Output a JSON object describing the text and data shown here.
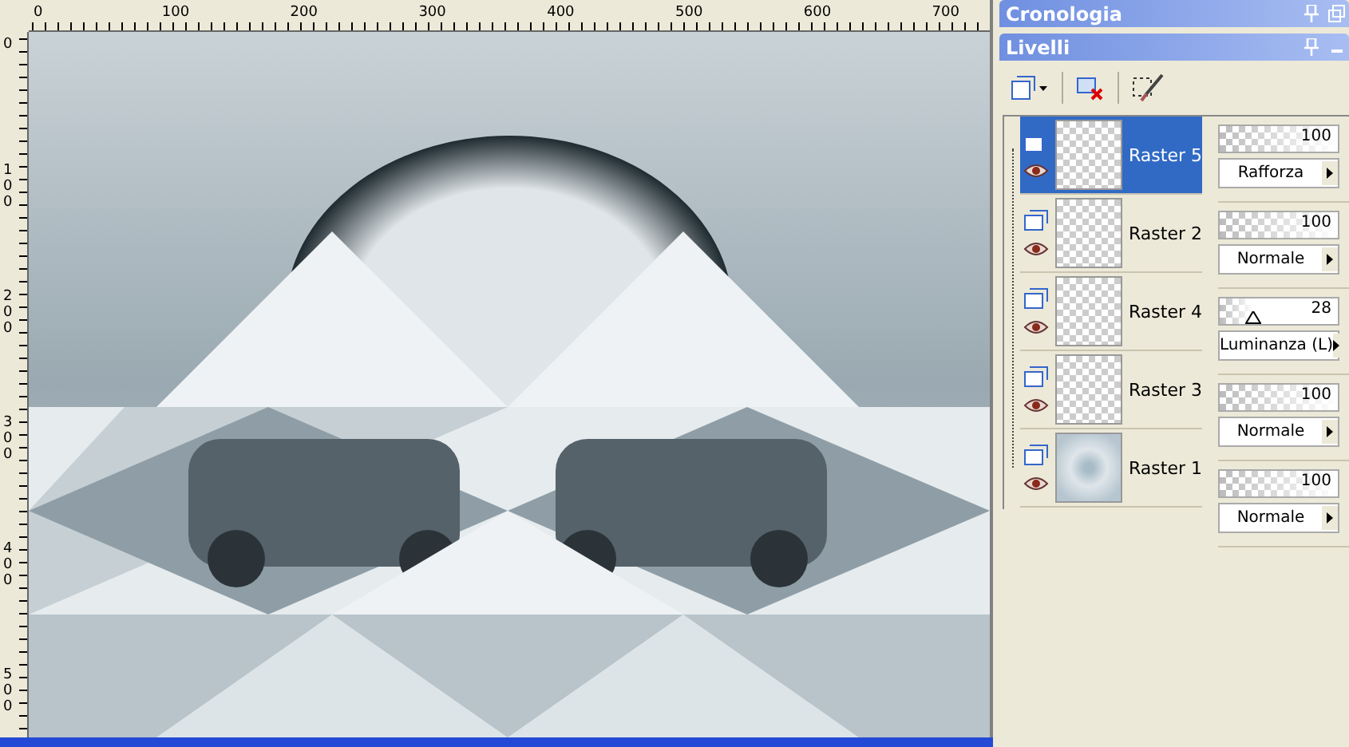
{
  "rulers": {
    "horizontal": [
      "0",
      "100",
      "200",
      "300",
      "400",
      "500",
      "600",
      "700"
    ],
    "vertical": [
      "0",
      "100",
      "200",
      "300",
      "400",
      "500"
    ]
  },
  "history_panel": {
    "title": "Cronologia"
  },
  "layers_panel": {
    "title": "Livelli",
    "layers": [
      {
        "name": "Raster 5",
        "selected": true,
        "kind": "transparent",
        "opacity": "100",
        "level": 1,
        "blend_mode": "Rafforza"
      },
      {
        "name": "Raster 2",
        "selected": false,
        "kind": "transparent",
        "opacity": "100",
        "level": 1,
        "blend_mode": "Normale"
      },
      {
        "name": "Raster 4",
        "selected": false,
        "kind": "transparent",
        "opacity": "28",
        "level": 0.28,
        "blend_mode": "Luminanza (L)"
      },
      {
        "name": "Raster 3",
        "selected": false,
        "kind": "transparent",
        "opacity": "100",
        "level": 1,
        "blend_mode": "Normale"
      },
      {
        "name": "Raster 1",
        "selected": false,
        "kind": "opaque",
        "opacity": "100",
        "level": 1,
        "blend_mode": "Normale"
      }
    ]
  }
}
